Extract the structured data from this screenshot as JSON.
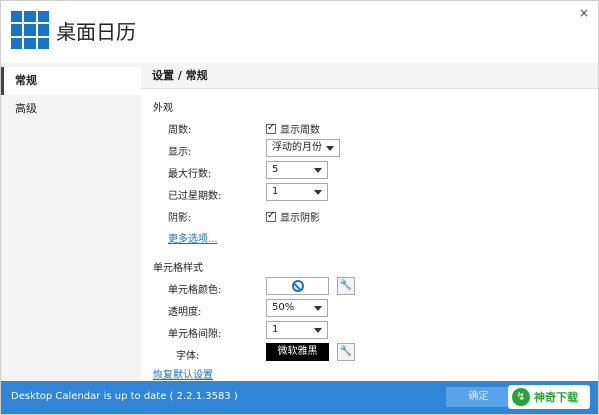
{
  "header": {
    "title": "桌面日历",
    "close_glyph": "×"
  },
  "sidebar": {
    "items": [
      {
        "label": "常规",
        "active": true
      },
      {
        "label": "高级",
        "active": false
      }
    ]
  },
  "main": {
    "title": "设置 / 常规",
    "appearance": {
      "label": "外观",
      "week_number": {
        "label": "周数:",
        "checkbox_label": "显示周数",
        "checked": true
      },
      "display": {
        "label": "显示:",
        "value": "浮动的月份"
      },
      "max_rows": {
        "label": "最大行数:",
        "value": "5"
      },
      "past_weeks": {
        "label": "已过星期数:",
        "value": "1"
      },
      "shadow": {
        "label": "阴影:",
        "checkbox_label": "显示阴影",
        "checked": true
      },
      "more_options": "更多选项..."
    },
    "cell_style": {
      "label": "单元格样式",
      "color": {
        "label": "单元格颜色:"
      },
      "transparency": {
        "label": "透明度:",
        "value": "50%"
      },
      "spacing": {
        "label": "单元格间隙:",
        "value": "1"
      },
      "font": {
        "label": "字体:",
        "value": "微软雅黑"
      },
      "restore_defaults": "恢复默认设置"
    }
  },
  "status_bar": {
    "text": "Desktop Calendar is up to date ( 2.2.1.3583 )",
    "button_label": "确定",
    "watermark": "神奇下载",
    "watermark_icon": "↯"
  },
  "colors": {
    "accent": "#1a73c7",
    "status_bar": "#2f86d8",
    "watermark_green": "#29a538"
  }
}
